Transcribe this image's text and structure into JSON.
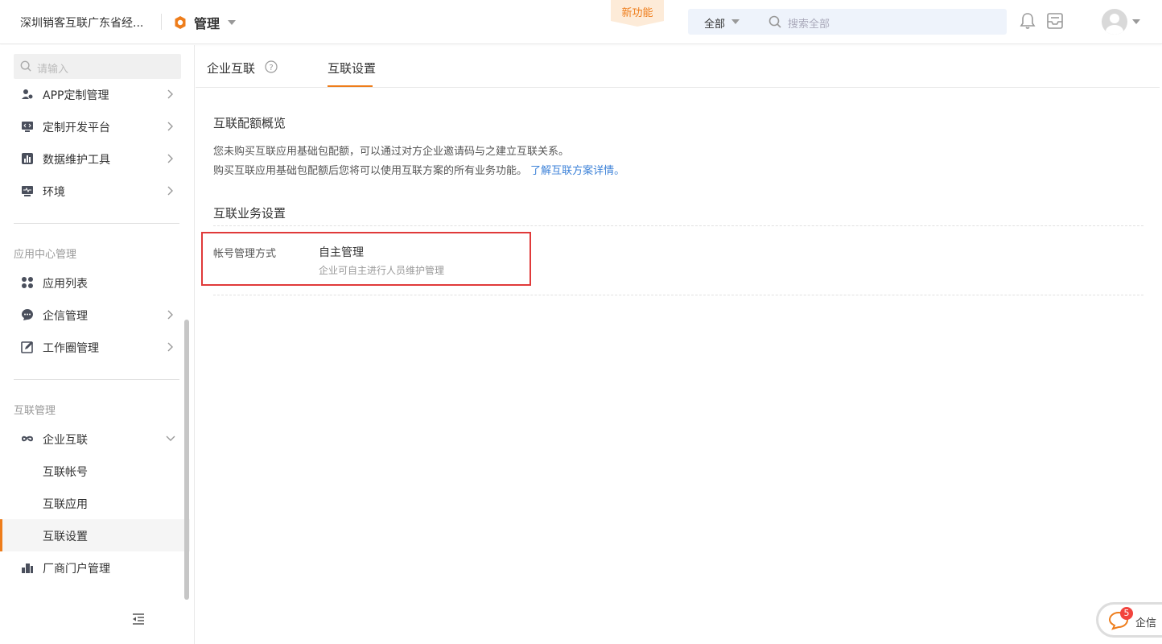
{
  "header": {
    "company": "深圳销客互联广东省经...",
    "app_title": "管理",
    "new_feature": "新功能",
    "search_scope": "全部",
    "search_placeholder": "搜索全部"
  },
  "sidebar": {
    "search_placeholder": "请输入",
    "top_items": [
      {
        "label": "APP定制管理",
        "icon": "app-custom-icon"
      },
      {
        "label": "定制开发平台",
        "icon": "code-icon"
      },
      {
        "label": "数据维护工具",
        "icon": "bar-chart-icon"
      },
      {
        "label": "环境",
        "icon": "monitor-icon"
      }
    ],
    "group1": {
      "label": "应用中心管理",
      "items": [
        {
          "label": "应用列表",
          "icon": "grid-icon"
        },
        {
          "label": "企信管理",
          "icon": "chat-icon"
        },
        {
          "label": "工作圈管理",
          "icon": "edit-icon"
        }
      ]
    },
    "group2": {
      "label": "互联管理",
      "parent": {
        "label": "企业互联",
        "icon": "link-icon"
      },
      "children": [
        "互联帐号",
        "互联应用",
        "互联设置"
      ],
      "last_item": {
        "label": "厂商门户管理",
        "icon": "building-icon"
      }
    }
  },
  "tabs": {
    "tab1": "企业互联",
    "tab2": "互联设置",
    "active": "互联设置"
  },
  "content": {
    "quota_title": "互联配额概览",
    "quota_desc1": "您未购买互联应用基础包配额，可以通过对方企业邀请码与之建立互联关系。",
    "quota_desc2": "购买互联应用基础包配额后您将可以使用互联方案的所有业务功能。",
    "quota_link": "了解互联方案详情。",
    "business_title": "互联业务设置",
    "setting_label": "帐号管理方式",
    "setting_value": "自主管理",
    "setting_desc": "企业可自主进行人员维护管理"
  },
  "chat_float": {
    "badge": "5",
    "label": "企信"
  },
  "colors": {
    "accent": "#ee7d1b",
    "link": "#3d82d8",
    "highlight": "#e03a3a",
    "badge": "#f2443e"
  }
}
